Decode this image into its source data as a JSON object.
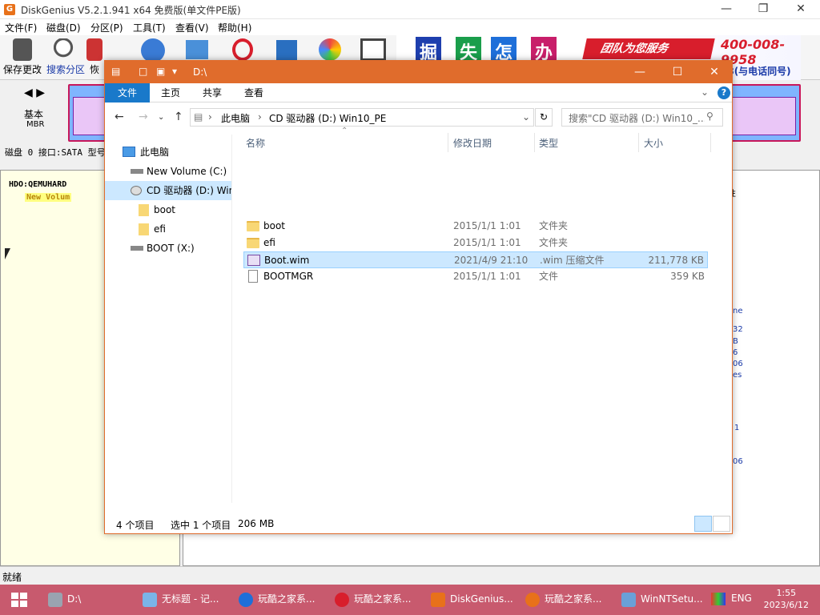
{
  "diskgenius": {
    "title": "DiskGenius V5.2.1.941 x64 免费版(单文件PE版)",
    "logo": "G",
    "menu": [
      "文件(F)",
      "磁盘(D)",
      "分区(P)",
      "工具(T)",
      "查看(V)",
      "帮助(H)"
    ],
    "toolbar": [
      "保存更改",
      "搜索分区",
      "恢"
    ],
    "banner": {
      "chars": [
        "掘",
        "失",
        "怎",
        "办"
      ],
      "slogan": "团队为您服务",
      "phone": "400-008-9958",
      "phone_note": "58(与电话同号)"
    },
    "disk_nav": "◀ ▶",
    "disk_type": "基本",
    "disk_style": "MBR",
    "disk_info": "磁盘 0 接口:SATA  型号",
    "tree_disk": "HDO:QEMUHARD",
    "tree_vol": "New Volum",
    "right_letters": [
      "性",
      "ne",
      "32",
      "B",
      "6",
      "06",
      "es",
      "1",
      "06"
    ],
    "status": "就绪"
  },
  "explorer": {
    "title_path": "D:\\",
    "tabs": [
      "文件",
      "主页",
      "共享",
      "查看"
    ],
    "breadcrumb": [
      "此电脑",
      "CD 驱动器 (D:) Win10_PE"
    ],
    "search_placeholder": "搜索\"CD 驱动器 (D:) Win10_...",
    "nav": [
      {
        "label": "此电脑",
        "icon": "pc-icon"
      },
      {
        "label": "New Volume (C:)",
        "icon": "drive-icon"
      },
      {
        "label": "CD 驱动器 (D:) Win",
        "icon": "cd-icon",
        "selected": true
      },
      {
        "label": "boot",
        "icon": "folder-icon"
      },
      {
        "label": "efi",
        "icon": "folder-icon"
      },
      {
        "label": "BOOT (X:)",
        "icon": "drive-icon"
      }
    ],
    "columns": {
      "name": "名称",
      "date": "修改日期",
      "type": "类型",
      "size": "大小"
    },
    "files": [
      {
        "name": "boot",
        "date": "2015/1/1 1:01",
        "type": "文件夹",
        "size": "",
        "icon": "folder"
      },
      {
        "name": "efi",
        "date": "2015/1/1 1:01",
        "type": "文件夹",
        "size": "",
        "icon": "folder"
      },
      {
        "name": "Boot.wim",
        "date": "2021/4/9 21:10",
        "type": ".wim 压缩文件",
        "size": "211,778 KB",
        "icon": "wim",
        "selected": true
      },
      {
        "name": "BOOTMGR",
        "date": "2015/1/1 1:01",
        "type": "文件",
        "size": "359 KB",
        "icon": "file"
      }
    ],
    "status_count": "4 个项目",
    "status_selected": "选中 1 个项目",
    "status_size": "206 MB"
  },
  "taskbar": {
    "items": [
      {
        "label": "D:\\",
        "color": "#9aa3b0"
      },
      {
        "label": "无标题 - 记...",
        "color": "#7ab4e8"
      },
      {
        "label": "玩酷之家系...",
        "color": "#1e6fd9"
      },
      {
        "label": "玩酷之家系...",
        "color": "#d81e2c"
      },
      {
        "label": "DiskGenius...",
        "color": "#e8711a"
      },
      {
        "label": "玩酷之家系...",
        "color": "#e8711a"
      },
      {
        "label": "WinNTSetu...",
        "color": "#6aa0d8"
      }
    ],
    "lang": "ENG",
    "time": "1:55",
    "date": "2023/6/12"
  }
}
